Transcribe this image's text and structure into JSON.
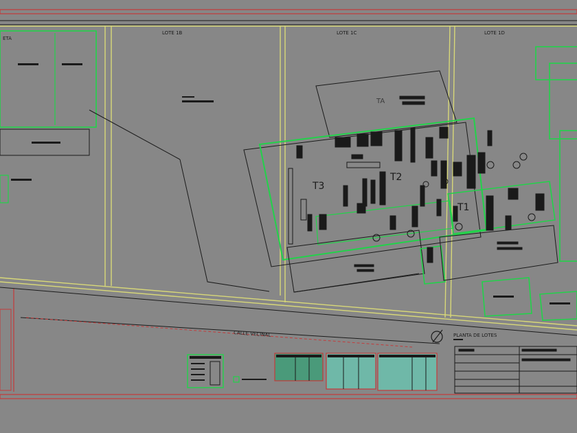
{
  "drawing": {
    "lot_labels": {
      "lote_1a": "ETA",
      "lote_1b": "LOTE 1B",
      "lote_1c": "LOTE 1C",
      "lote_1d": "LOTE 1D"
    },
    "building_labels": {
      "t1": "T1",
      "t2": "T2",
      "t3": "T3",
      "ta": "TA"
    },
    "street_label": "CALLE VECINAL",
    "plan_title": "PLANTA DE LOTES"
  },
  "colors": {
    "background": "#878787",
    "lot_line": "#d8d878",
    "wall_line": "#22d24a",
    "border_line": "#c43a3a",
    "ink": "#1a1a1a"
  }
}
